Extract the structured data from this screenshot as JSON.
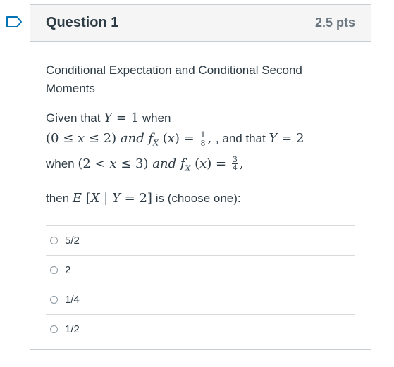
{
  "question": {
    "title": "Question 1",
    "points": "2.5 pts",
    "subtitle": "Conditional Expectation and Conditional Second Moments",
    "prompt": {
      "given_that": "Given that",
      "when": "when",
      "and_that": ", and that",
      "then": "then",
      "choose": "is (choose one):"
    },
    "answers": [
      {
        "label": "5/2"
      },
      {
        "label": "2"
      },
      {
        "label": "1/4"
      },
      {
        "label": "1/2"
      }
    ]
  }
}
